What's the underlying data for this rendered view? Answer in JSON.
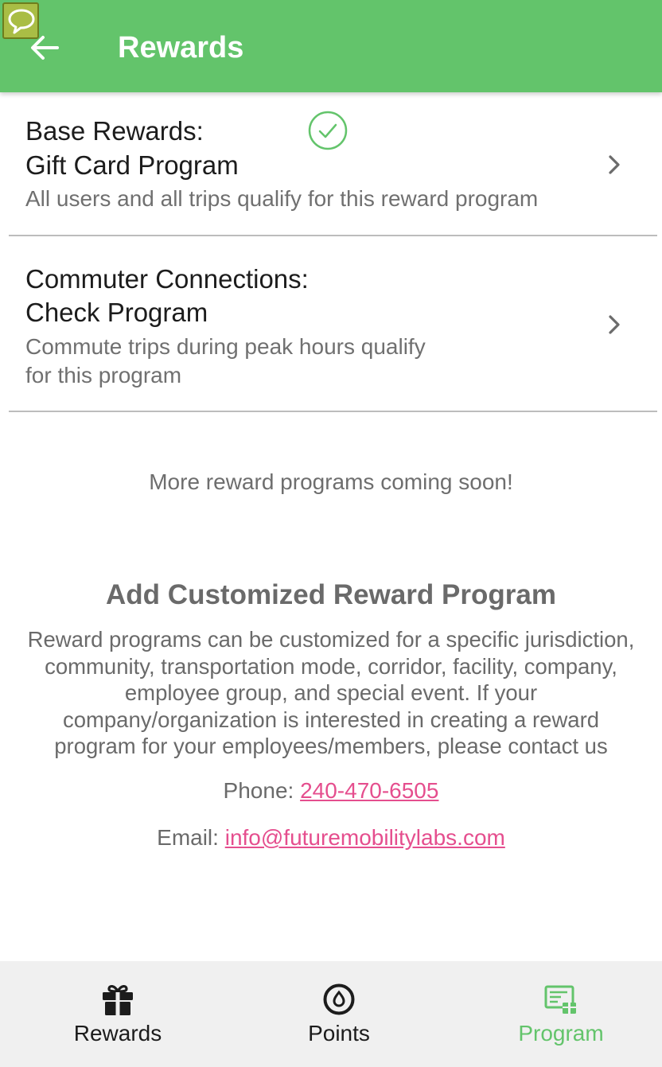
{
  "app_bar": {
    "title": "Rewards",
    "back_icon": "arrow-left-icon",
    "chat_icon": "chat-bubble-icon",
    "color": "#63c46b"
  },
  "programs": [
    {
      "title_line1": "Base Rewards:",
      "title_line2": "Gift Card Program",
      "description_line1": "All users and all trips qualify for this reward program",
      "description_line2": "",
      "enrolled": true,
      "status_icon": "check-circle-icon"
    },
    {
      "title_line1": "Commuter Connections:",
      "title_line2": "Check Program",
      "description_line1": "Commute trips during peak hours qualify",
      "description_line2": "for this program",
      "enrolled": false
    }
  ],
  "coming_soon": "More reward programs coming soon!",
  "custom_program": {
    "title": "Add Customized Reward Program",
    "description": "Reward programs can be customized for a specific jurisdiction, community, transportation mode, corridor, facility, company, employee group, and special event. If your company/organization is interested in creating a reward program for your employees/members, please contact us",
    "phone_label": "Phone: ",
    "phone": "240-470-6505",
    "email_label": "Email: ",
    "email": "info@futuremobilitylabs.com",
    "link_color": "#e54e8e"
  },
  "bottom_nav": {
    "items": [
      {
        "label": "Rewards",
        "icon": "gift-icon",
        "active": false
      },
      {
        "label": "Points",
        "icon": "points-coin-icon",
        "active": false
      },
      {
        "label": "Program",
        "icon": "program-card-icon",
        "active": true
      }
    ],
    "active_color": "#63c46b"
  }
}
